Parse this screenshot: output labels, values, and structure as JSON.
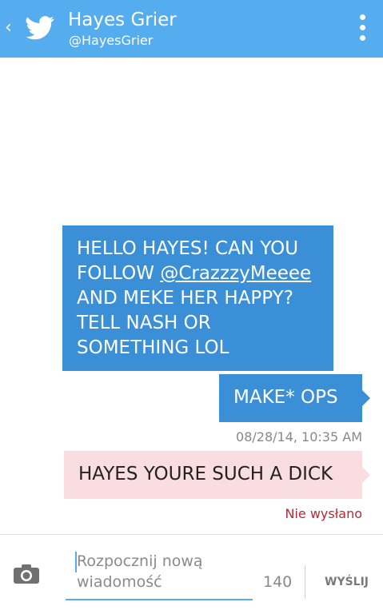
{
  "header": {
    "back_icon": "chevron-left-icon",
    "logo_icon": "twitter-bird-icon",
    "name": "Hayes Grier",
    "handle": "@HayesGrier",
    "menu_icon": "overflow-menu-icon",
    "color": "#55acee"
  },
  "messages": [
    {
      "direction": "sent",
      "text_before": "HELLO HAYES! CAN YOU FOLLOW ",
      "mention": "@CrazzzyMeeee",
      "text_after": " AND MEKE HER HAPPY? TELL NASH OR SOMETHING LOL",
      "color": "#3a8fd6"
    },
    {
      "direction": "sent",
      "text": "MAKE* OPS",
      "color": "#3a8fd6"
    },
    {
      "timestamp": "08/28/14, 10:35 AM"
    },
    {
      "direction": "failed",
      "text": "HAYES YOURE SUCH A DICK",
      "color": "#f9dde0"
    },
    {
      "status": "Nie wysłano",
      "color": "#b52a36"
    }
  ],
  "composer": {
    "camera_icon": "camera-icon",
    "placeholder": "Rozpocznij nową wiadomość",
    "char_count": "140",
    "send_label": "WYŚLIJ"
  }
}
